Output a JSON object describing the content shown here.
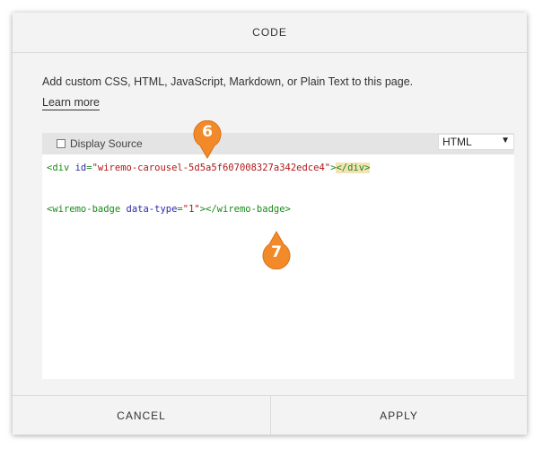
{
  "dialog": {
    "title": "CODE",
    "description": "Add custom CSS, HTML, JavaScript, Markdown, or Plain Text to this page.",
    "learn_more": "Learn more",
    "display_source_label": "Display Source",
    "display_source_checked": false,
    "language": {
      "selected": "HTML",
      "arrow": "▼"
    },
    "code": {
      "line1": {
        "open": "<div ",
        "attr": "id",
        "eq": "=",
        "value": "\"wiremo-carousel-5d5a5f607008327a342edce4\"",
        "close_bracket": ">",
        "end_tag": "</div>"
      },
      "line2": {
        "open": "<wiremo-badge ",
        "attr": "data-type",
        "eq": "=",
        "value": "\"1\"",
        "close": "></wiremo-badge>"
      }
    },
    "cancel_label": "CANCEL",
    "apply_label": "APPLY"
  },
  "annotations": [
    {
      "label": "6",
      "color": "#f28a2a"
    },
    {
      "label": "7",
      "color": "#f28a2a"
    }
  ]
}
